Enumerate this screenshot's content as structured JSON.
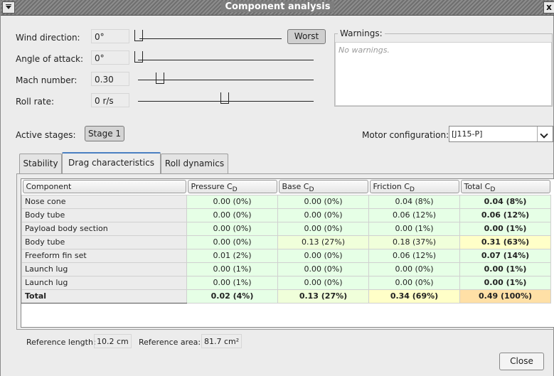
{
  "window": {
    "title": "Component analysis",
    "close_glyph": "x"
  },
  "params": {
    "wind_direction": {
      "label": "Wind direction:",
      "value": "0°",
      "level": 0.0
    },
    "angle_of_attack": {
      "label": "Angle of attack:",
      "value": "0°",
      "level": 0.0
    },
    "mach": {
      "label": "Mach number:",
      "value": "0.30",
      "level": 0.1
    },
    "roll_rate": {
      "label": "Roll rate:",
      "value": "0 r/s",
      "level": 0.5
    },
    "worst_label": "Worst"
  },
  "warnings": {
    "legend": "Warnings:",
    "text": "No warnings."
  },
  "stages": {
    "label": "Active stages:",
    "stage": "Stage 1"
  },
  "motor": {
    "label": "Motor configuration:",
    "value": "[J115-P]"
  },
  "tabs": [
    {
      "label": "Stability",
      "active": false
    },
    {
      "label": "Drag characteristics",
      "active": true
    },
    {
      "label": "Roll dynamics",
      "active": false
    }
  ],
  "table": {
    "headers": [
      "Component",
      "Pressure C",
      "Base C",
      "Friction C",
      "Total C"
    ],
    "subscript": "D",
    "rows": [
      {
        "name": "Nose cone",
        "pressure": "0.00 (0%)",
        "base": "0.00 (0%)",
        "friction": "0.04 (8%)",
        "total": "0.04 (8%)"
      },
      {
        "name": "Body tube",
        "pressure": "0.00 (0%)",
        "base": "0.00 (0%)",
        "friction": "0.06 (12%)",
        "total": "0.06 (12%)"
      },
      {
        "name": "Payload body section",
        "pressure": "0.00 (0%)",
        "base": "0.00 (0%)",
        "friction": "0.00 (1%)",
        "total": "0.00 (1%)"
      },
      {
        "name": "Body tube",
        "pressure": "0.00 (0%)",
        "base": "0.13 (27%)",
        "friction": "0.18 (37%)",
        "total": "0.31 (63%)"
      },
      {
        "name": "Freeform fin set",
        "pressure": "0.01 (2%)",
        "base": "0.00 (0%)",
        "friction": "0.06 (12%)",
        "total": "0.07 (14%)"
      },
      {
        "name": "Launch lug",
        "pressure": "0.00 (1%)",
        "base": "0.00 (0%)",
        "friction": "0.00 (0%)",
        "total": "0.00 (1%)"
      },
      {
        "name": "Launch lug",
        "pressure": "0.00 (1%)",
        "base": "0.00 (0%)",
        "friction": "0.00 (0%)",
        "total": "0.00 (1%)"
      },
      {
        "name": "Total",
        "pressure": "0.02 (4%)",
        "base": "0.13 (27%)",
        "friction": "0.34 (69%)",
        "total": "0.49 (100%)"
      }
    ]
  },
  "reference": {
    "length_label": "Reference length:",
    "length_value": "10.2 cm",
    "area_label": "Reference area:",
    "area_value": "81.7 cm²"
  },
  "buttons": {
    "close": "Close"
  }
}
